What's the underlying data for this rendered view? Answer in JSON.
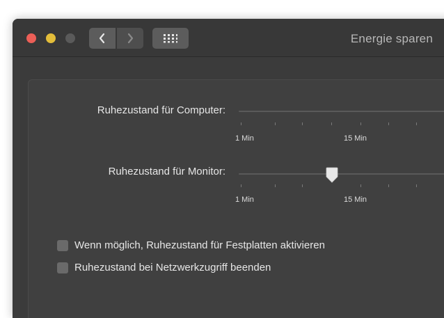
{
  "window": {
    "title": "Energie sparen"
  },
  "toolbar": {
    "back_icon": "chevron-left-icon",
    "forward_icon": "chevron-right-icon",
    "grid_icon": "grid-icon"
  },
  "sliders": [
    {
      "label": "Ruhezustand für Computer:",
      "tick_labels": [
        "1 Min",
        "15 Min"
      ],
      "has_visible_thumb": false
    },
    {
      "label": "Ruhezustand für Monitor:",
      "tick_labels": [
        "1 Min",
        "15 Min"
      ],
      "value_label": "15 Min"
    }
  ],
  "options": [
    {
      "label": "Wenn möglich, Ruhezustand für Festplatten aktivieren",
      "checked": false
    },
    {
      "label": "Ruhezustand bei Netzwerkzugriff beenden",
      "checked": false
    }
  ],
  "colors": {
    "close": "#ec5f57",
    "minimize": "#e3bd3a",
    "maximize_disabled": "#5a5a5a",
    "window_bg": "#3b3b3b",
    "panel_bg": "#404040"
  }
}
